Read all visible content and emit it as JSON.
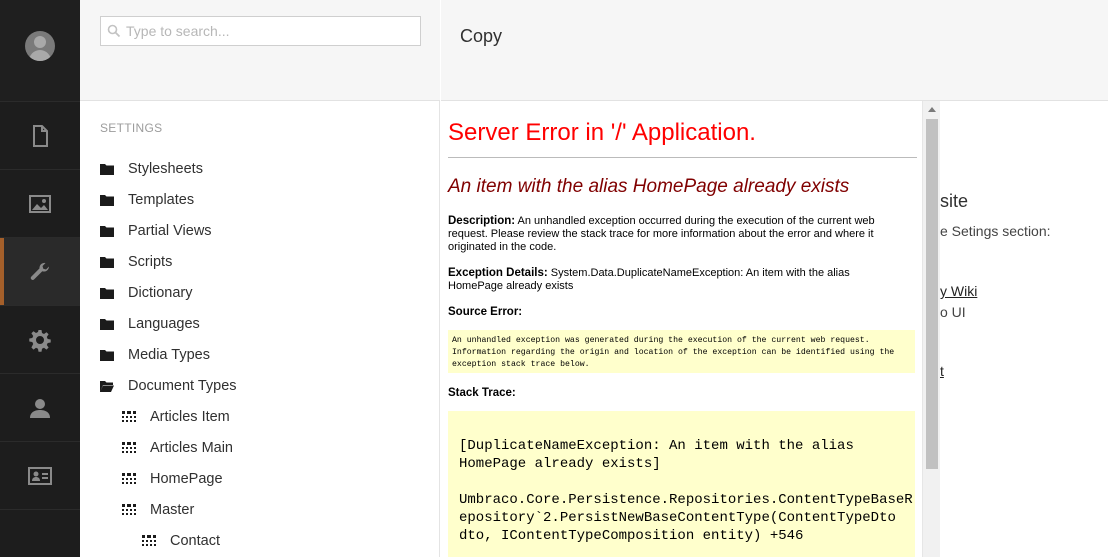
{
  "rail": {
    "items": [
      {
        "name": "content",
        "icon": "document-icon",
        "active": false
      },
      {
        "name": "media",
        "icon": "image-icon",
        "active": false
      },
      {
        "name": "settings",
        "icon": "wrench-icon",
        "active": true
      },
      {
        "name": "developer",
        "icon": "gear-icon",
        "active": false
      },
      {
        "name": "users",
        "icon": "user-icon",
        "active": false
      },
      {
        "name": "members",
        "icon": "id-card-icon",
        "active": false
      }
    ]
  },
  "search": {
    "placeholder": "Type to search..."
  },
  "tree": {
    "section_title": "SETTINGS",
    "items": [
      {
        "label": "Stylesheets",
        "level": 0,
        "icon": "folder-icon"
      },
      {
        "label": "Templates",
        "level": 0,
        "icon": "folder-icon"
      },
      {
        "label": "Partial Views",
        "level": 0,
        "icon": "folder-icon"
      },
      {
        "label": "Scripts",
        "level": 0,
        "icon": "folder-icon"
      },
      {
        "label": "Dictionary",
        "level": 0,
        "icon": "folder-icon"
      },
      {
        "label": "Languages",
        "level": 0,
        "icon": "folder-icon"
      },
      {
        "label": "Media Types",
        "level": 0,
        "icon": "folder-icon"
      },
      {
        "label": "Document Types",
        "level": 0,
        "icon": "folder-open-icon"
      },
      {
        "label": "Articles Item",
        "level": 1,
        "icon": "doctype-icon"
      },
      {
        "label": "Articles Main",
        "level": 1,
        "icon": "doctype-icon"
      },
      {
        "label": "HomePage",
        "level": 1,
        "icon": "doctype-icon"
      },
      {
        "label": "Master",
        "level": 1,
        "icon": "doctype-icon"
      },
      {
        "label": "Contact",
        "level": 2,
        "icon": "doctype-icon"
      }
    ]
  },
  "editor": {
    "title": "Copy"
  },
  "background": {
    "lines": [
      {
        "text": "site"
      },
      {
        "text": "e Setings section:"
      },
      {
        "text": "y Wiki",
        "underline": true
      },
      {
        "text": "o UI"
      },
      {
        "text": "t",
        "underline": true
      }
    ]
  },
  "error": {
    "heading": "Server Error in '/' Application.",
    "message": "An item with the alias HomePage already exists",
    "description_label": "Description:",
    "description_text": "An unhandled exception occurred during the execution of the current web request. Please review the stack trace for more information about the error and where it originated in the code.",
    "exception_label": "Exception Details:",
    "exception_text": "System.Data.DuplicateNameException: An item with the alias HomePage already exists",
    "source_label": "Source Error:",
    "source_text": "An unhandled exception was generated during the execution of the current web request. Information regarding the origin and location of the exception can be identified using the exception stack trace below.",
    "stack_label": "Stack Trace:",
    "stack_text": "[DuplicateNameException: An item with the alias\nHomePage already exists]\n\nUmbraco.Core.Persistence.Repositories.ContentTypeBaseR\nepository`2.PersistNewBaseContentType(ContentTypeDto\ndto, IContentTypeComposition entity) +546"
  }
}
